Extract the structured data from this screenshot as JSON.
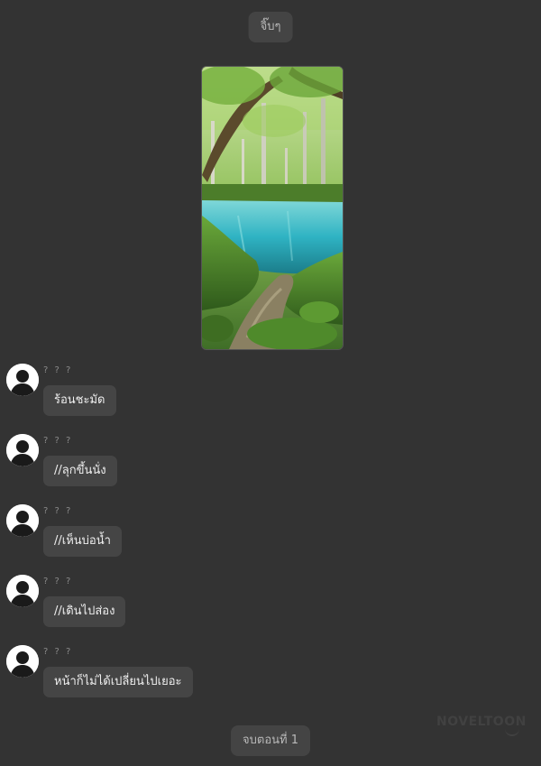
{
  "header": {
    "chapter_label": "จิ๊บๆ"
  },
  "image": {
    "description_icon": "forest-pond-image"
  },
  "messages": [
    {
      "sender": "? ? ?",
      "text": "ร้อนชะมัด"
    },
    {
      "sender": "? ? ?",
      "text": "//ลุกขึ้นนั่ง"
    },
    {
      "sender": "? ? ?",
      "text": "//เห็นบ่อน้ำ"
    },
    {
      "sender": "? ? ?",
      "text": "//เดินไปส่อง"
    },
    {
      "sender": "? ? ?",
      "text": "หน้าก็ไม่ได้เปลี่ยนไปเยอะ"
    }
  ],
  "footer": {
    "end_label": "จบตอนที่ 1"
  },
  "watermark": {
    "text": "NOVELTOON"
  },
  "colors": {
    "background": "#333333",
    "bubble": "#454545",
    "pill": "#444444"
  }
}
